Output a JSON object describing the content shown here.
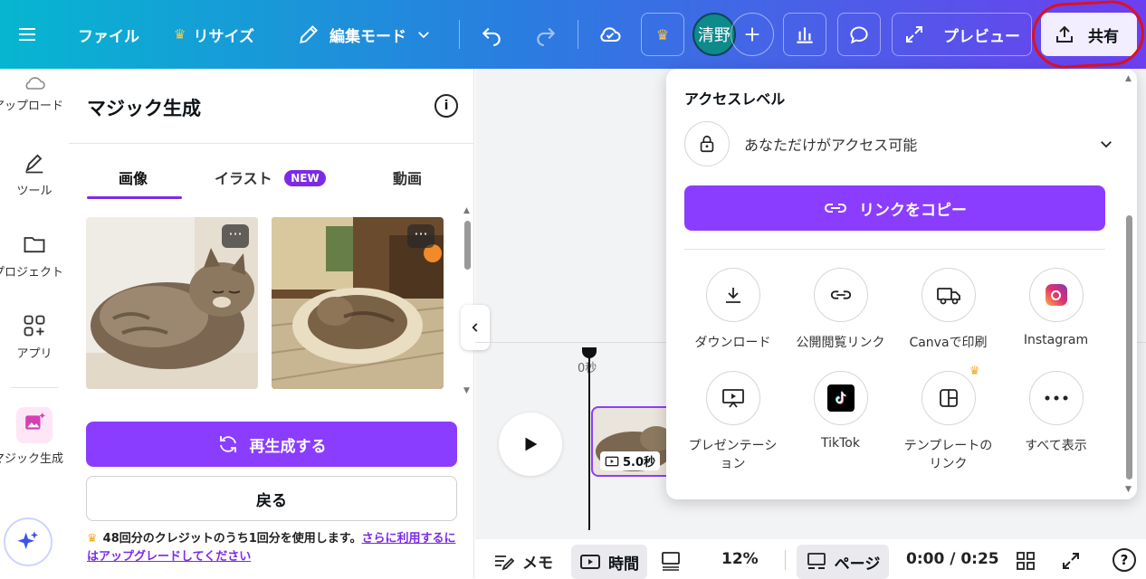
{
  "topbar": {
    "file_label": "ファイル",
    "resize_label": "リサイズ",
    "edit_mode_label": "編集モード",
    "avatar_text": "清野",
    "preview_label": "プレビュー",
    "share_label": "共有"
  },
  "sidebar": {
    "items": [
      {
        "label": "アップロード",
        "icon": "cloud-upload-icon"
      },
      {
        "label": "ツール",
        "icon": "pen-tool-icon"
      },
      {
        "label": "プロジェクト",
        "icon": "folder-icon"
      },
      {
        "label": "アプリ",
        "icon": "apps-icon"
      },
      {
        "label": "マジック生成",
        "icon": "magic-image-icon"
      }
    ]
  },
  "panel": {
    "title": "マジック生成",
    "tabs": [
      "画像",
      "イラスト",
      "動画"
    ],
    "new_badge": "NEW",
    "active_tab": "画像",
    "regenerate_label": "再生成する",
    "back_label": "戻る",
    "credit_text": "48回分のクレジットのうち1回分を使用します。",
    "upgrade_link": "さらに利用するにはアップグレードしてください",
    "more_dots": "···"
  },
  "timeline": {
    "marker_label": "0秒",
    "clip_duration": "5.0秒"
  },
  "bottombar": {
    "memo_label": "メモ",
    "time_label": "時間",
    "zoom": "12%",
    "page_label": "ページ",
    "timecode": "0:00 / 0:25",
    "help": "?"
  },
  "share": {
    "access_heading": "アクセスレベル",
    "access_value": "あなただけがアクセス可能",
    "copy_link_label": "リンクをコピー",
    "options": [
      {
        "label": "ダウンロード",
        "icon": "download-icon"
      },
      {
        "label": "公開閲覧リンク",
        "icon": "link-icon"
      },
      {
        "label": "Canvaで印刷",
        "icon": "truck-icon"
      },
      {
        "label": "Instagram",
        "icon": "instagram-icon"
      },
      {
        "label": "プレゼンテーション",
        "icon": "presentation-icon"
      },
      {
        "label": "TikTok",
        "icon": "tiktok-icon"
      },
      {
        "label": "テンプレートのリンク",
        "icon": "template-icon"
      },
      {
        "label": "すべて表示",
        "icon": "more-icon"
      }
    ]
  },
  "colors": {
    "accent": "#7d2ae8",
    "annotation": "#e0101e"
  }
}
